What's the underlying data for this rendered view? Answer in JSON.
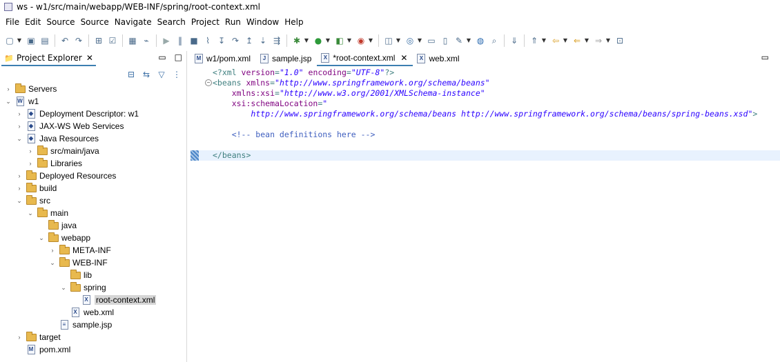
{
  "window": {
    "title": "ws - w1/src/main/webapp/WEB-INF/spring/root-context.xml"
  },
  "menu": [
    "File",
    "Edit",
    "Source",
    "Source",
    "Navigate",
    "Search",
    "Project",
    "Run",
    "Window",
    "Help"
  ],
  "toolbar": {
    "icons": [
      "new-icon",
      "save-icon",
      "save-all-icon",
      "undo-icon",
      "redo-icon",
      "open-type-icon",
      "task-icon",
      "terminal-icon",
      "link-icon",
      "resume-icon",
      "suspend-icon",
      "stop-icon",
      "disconnect-icon",
      "step-into-icon",
      "step-over-icon",
      "step-return-icon",
      "drop-to-frame-icon",
      "use-step-filters-icon",
      "debug-icon",
      "run-icon",
      "coverage-icon",
      "external-tools-icon",
      "new-java-project-icon",
      "new-class-icon",
      "open-folder-icon",
      "open-file-icon",
      "tools-icon",
      "web-browser-icon",
      "search-icon",
      "next-annotation-icon",
      "previous-annotation-icon",
      "last-edit-icon",
      "back-icon",
      "forward-icon",
      "open-perspective-icon"
    ]
  },
  "explorer": {
    "tab_label": "Project Explorer",
    "tree": [
      {
        "label": "Servers",
        "depth": 0,
        "expanded": false,
        "icon": "folder"
      },
      {
        "label": "w1",
        "depth": 0,
        "expanded": true,
        "icon": "project"
      },
      {
        "label": "Deployment Descriptor: w1",
        "depth": 1,
        "expanded": false,
        "icon": "descriptor"
      },
      {
        "label": "JAX-WS Web Services",
        "depth": 1,
        "expanded": false,
        "icon": "webservices"
      },
      {
        "label": "Java Resources",
        "depth": 1,
        "expanded": true,
        "icon": "javares"
      },
      {
        "label": "src/main/java",
        "depth": 2,
        "expanded": false,
        "icon": "package-folder"
      },
      {
        "label": "Libraries",
        "depth": 2,
        "expanded": false,
        "icon": "library"
      },
      {
        "label": "Deployed Resources",
        "depth": 1,
        "expanded": false,
        "icon": "deployed"
      },
      {
        "label": "build",
        "depth": 1,
        "expanded": false,
        "icon": "folder"
      },
      {
        "label": "src",
        "depth": 1,
        "expanded": true,
        "icon": "folder"
      },
      {
        "label": "main",
        "depth": 2,
        "expanded": true,
        "icon": "folder"
      },
      {
        "label": "java",
        "depth": 3,
        "expanded": null,
        "icon": "folder"
      },
      {
        "label": "webapp",
        "depth": 3,
        "expanded": true,
        "icon": "folder"
      },
      {
        "label": "META-INF",
        "depth": 4,
        "expanded": false,
        "icon": "folder"
      },
      {
        "label": "WEB-INF",
        "depth": 4,
        "expanded": true,
        "icon": "folder"
      },
      {
        "label": "lib",
        "depth": 5,
        "expanded": null,
        "icon": "folder"
      },
      {
        "label": "spring",
        "depth": 5,
        "expanded": true,
        "icon": "folder"
      },
      {
        "label": "root-context.xml",
        "depth": 6,
        "expanded": null,
        "icon": "xml",
        "selected": true
      },
      {
        "label": "web.xml",
        "depth": 5,
        "expanded": null,
        "icon": "xml"
      },
      {
        "label": "sample.jsp",
        "depth": 4,
        "expanded": null,
        "icon": "jsp"
      },
      {
        "label": "target",
        "depth": 1,
        "expanded": false,
        "icon": "folder"
      },
      {
        "label": "pom.xml",
        "depth": 1,
        "expanded": null,
        "icon": "pom"
      }
    ]
  },
  "editor": {
    "tabs": [
      {
        "label": "w1/pom.xml",
        "icon": "M",
        "active": false
      },
      {
        "label": "sample.jsp",
        "icon": "J",
        "active": false
      },
      {
        "label": "*root-context.xml",
        "icon": "X",
        "active": true
      },
      {
        "label": "web.xml",
        "icon": "X",
        "active": false
      }
    ],
    "lines": [
      {
        "parts": [
          [
            "pi",
            "<?xml "
          ],
          [
            "attr",
            "version"
          ],
          [
            "pi",
            "="
          ],
          [
            "val",
            "\"1.0\""
          ],
          [
            "pi",
            " "
          ],
          [
            "attr",
            "encoding"
          ],
          [
            "pi",
            "="
          ],
          [
            "val",
            "\"UTF-8\""
          ],
          [
            "pi",
            "?>"
          ]
        ],
        "fold": false,
        "current": false
      },
      {
        "parts": [
          [
            "tag",
            "<beans "
          ],
          [
            "attr",
            "xmlns"
          ],
          [
            "tag",
            "="
          ],
          [
            "val",
            "\"http://www.springframework.org/schema/beans\""
          ]
        ],
        "fold": true,
        "current": false
      },
      {
        "parts": [
          [
            "tag",
            "    "
          ],
          [
            "attr",
            "xmlns:xsi"
          ],
          [
            "tag",
            "="
          ],
          [
            "val",
            "\"http://www.w3.org/2001/XMLSchema-instance\""
          ]
        ],
        "fold": false,
        "current": false
      },
      {
        "parts": [
          [
            "tag",
            "    "
          ],
          [
            "attr",
            "xsi:schemaLocation"
          ],
          [
            "tag",
            "="
          ],
          [
            "val",
            "\""
          ]
        ],
        "fold": false,
        "current": false
      },
      {
        "parts": [
          [
            "tag",
            "        "
          ],
          [
            "val",
            "http://www.springframework.org/schema/beans http://www.springframework.org/schema/beans/spring-beans.xsd\""
          ],
          [
            "tag",
            ">"
          ]
        ],
        "fold": false,
        "current": false
      },
      {
        "parts": [
          [
            "tag",
            ""
          ]
        ],
        "fold": false,
        "current": false
      },
      {
        "parts": [
          [
            "comment",
            "    <!-- bean definitions here -->"
          ]
        ],
        "fold": false,
        "current": false
      },
      {
        "parts": [
          [
            "tag",
            ""
          ]
        ],
        "fold": false,
        "current": false
      },
      {
        "parts": [
          [
            "tag",
            "</beans>"
          ]
        ],
        "fold": false,
        "current": true,
        "marker": true
      }
    ]
  }
}
